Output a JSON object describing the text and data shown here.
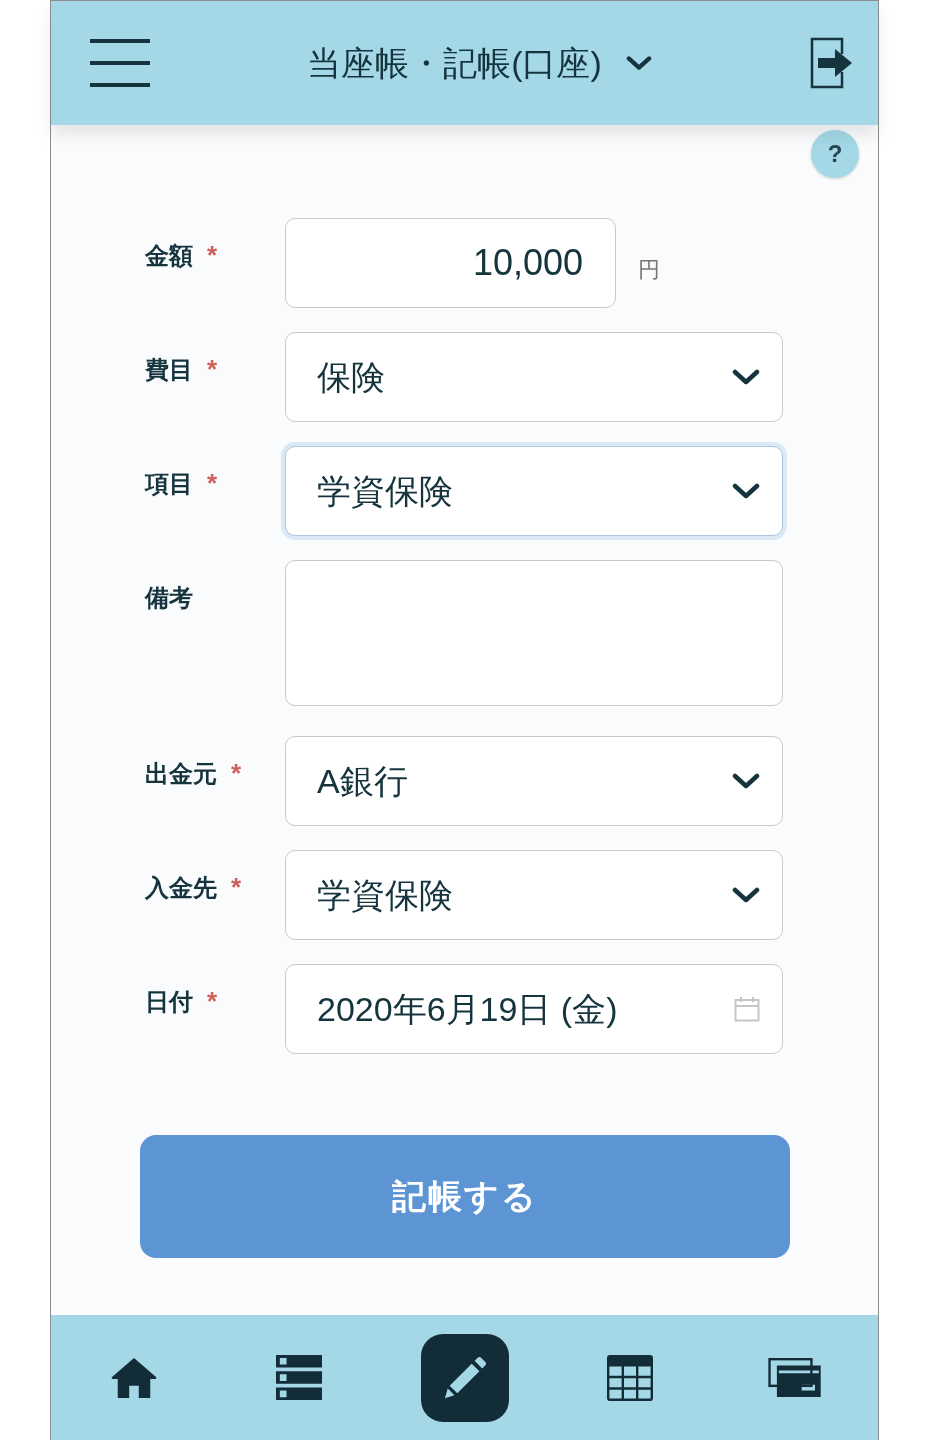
{
  "header": {
    "title": "当座帳・記帳(口座)"
  },
  "help_button": {
    "label": "?"
  },
  "form": {
    "fields": [
      {
        "kind": "amount",
        "label": "金額",
        "required_mark": "*",
        "value": "10,000",
        "unit": "円",
        "focused": false
      },
      {
        "kind": "select",
        "label": "費目",
        "required_mark": "*",
        "value": "保険",
        "focused": false
      },
      {
        "kind": "select",
        "label": "項目",
        "required_mark": "*",
        "value": "学資保険",
        "focused": true
      },
      {
        "kind": "textarea",
        "label": "備考",
        "focused": false
      },
      {
        "kind": "select",
        "label": "出金元",
        "required_mark": "*",
        "value": "A銀行",
        "focused": false
      },
      {
        "kind": "select",
        "label": "入金先",
        "required_mark": "*",
        "value": "学資保険",
        "focused": false
      },
      {
        "kind": "date",
        "label": "日付",
        "required_mark": "*",
        "value": "2020年6月19日 (金)",
        "focused": false
      }
    ]
  },
  "submit_button": {
    "label": "記帳する"
  },
  "bottom_nav": {
    "items": [
      {
        "kind": "home",
        "selected": false
      },
      {
        "kind": "list",
        "selected": false
      },
      {
        "kind": "edit",
        "selected": true
      },
      {
        "kind": "table",
        "selected": false
      },
      {
        "kind": "cards",
        "selected": false
      }
    ]
  }
}
